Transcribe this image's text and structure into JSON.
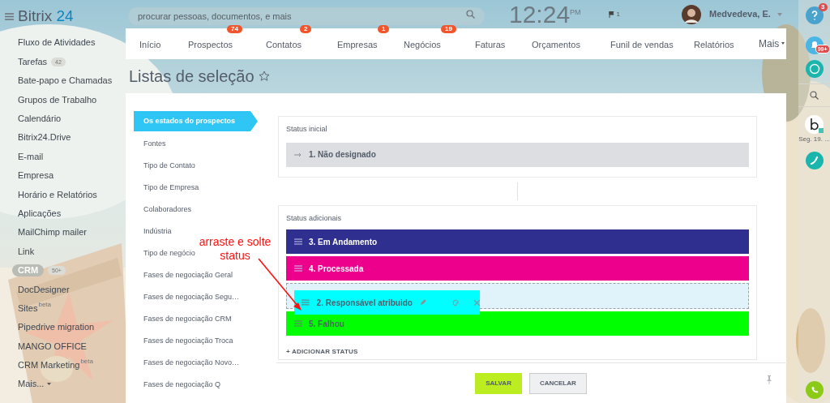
{
  "header": {
    "logo": {
      "text": "Bitrix",
      "accent": "24"
    },
    "search": {
      "placeholder": "procurar pessoas, documentos, e mais"
    },
    "clock": {
      "time": "12:24",
      "period": "PM"
    },
    "flags": "1",
    "user": "Medvedeva, E."
  },
  "sidebar": {
    "items": [
      {
        "label": "Fluxo de Atividades",
        "selected": false
      },
      {
        "label": "Tarefas",
        "counter": "42",
        "selected": false
      },
      {
        "label": "Bate-papo e Chamadas",
        "selected": false
      },
      {
        "label": "Grupos de Trabalho",
        "selected": false
      },
      {
        "label": "Calendário",
        "selected": false
      },
      {
        "label": "Bitrix24.Drive",
        "selected": false
      },
      {
        "label": "E-mail",
        "selected": false
      },
      {
        "label": "Empresa",
        "selected": false
      },
      {
        "label": "Horário e Relatórios",
        "selected": false
      },
      {
        "label": "Aplicações",
        "selected": false
      },
      {
        "label": "MailChimp mailer",
        "selected": false
      },
      {
        "label": "Link",
        "selected": false
      },
      {
        "label": "CRM",
        "counter": "50+",
        "selected": true
      },
      {
        "label": "DocDesigner",
        "selected": false
      },
      {
        "label": "Sites",
        "tag": "beta",
        "selected": false
      },
      {
        "label": "Pipedrive migration",
        "selected": false
      },
      {
        "label": "MANGO OFFICE",
        "selected": false
      },
      {
        "label": "CRM Marketing",
        "tag": "beta",
        "selected": false
      }
    ],
    "more": "Mais..."
  },
  "topnav": {
    "items": [
      {
        "label": "Início"
      },
      {
        "label": "Prospectos",
        "badge": "74"
      },
      {
        "label": "Contatos",
        "badge": "2"
      },
      {
        "label": "Empresas",
        "badge": "1"
      },
      {
        "label": "Negócios",
        "badge": "19"
      },
      {
        "label": "Faturas"
      },
      {
        "label": "Orçamentos"
      },
      {
        "label": "Funil de vendas"
      },
      {
        "label": "Relatórios"
      }
    ],
    "more": "Mais"
  },
  "page_title": "Listas de seleção",
  "lists": [
    {
      "label": "Os estados do prospectos",
      "selected": true
    },
    {
      "label": "Fontes",
      "selected": false
    },
    {
      "label": "Tipo de Contato",
      "selected": false
    },
    {
      "label": "Tipo de Empresa",
      "selected": false
    },
    {
      "label": "Colaboradores",
      "selected": false
    },
    {
      "label": "Indústria",
      "selected": false
    },
    {
      "label": "Tipo de negócio",
      "selected": false
    },
    {
      "label": "Fases de negociação Geral",
      "selected": false
    },
    {
      "label": "Fases de negociação Segu…",
      "selected": false
    },
    {
      "label": "Fases de negociação CRM",
      "selected": false
    },
    {
      "label": "Fases de negociação Troca",
      "selected": false
    },
    {
      "label": "Fases de negociação Novo…",
      "selected": false
    },
    {
      "label": "Fases de negociação Q",
      "selected": false
    }
  ],
  "initial_status": {
    "title": "Status inicial",
    "items": [
      {
        "label": "1. Não designado",
        "color": "#dcdee1"
      }
    ]
  },
  "additional_status": {
    "title": "Status adicionais",
    "items": [
      {
        "label": "3. Em Andamento",
        "color": "#2e2f8f",
        "kind": "item"
      },
      {
        "label": "4. Processada",
        "color": "#ec008c",
        "kind": "item"
      },
      {
        "kind": "placeholder"
      },
      {
        "label": "5. Falhou",
        "color": "#00ff00",
        "kind": "item"
      }
    ],
    "dragged": {
      "label": "2. Responsável atribuido",
      "color": "#00ffff"
    },
    "add": "+ ADICIONAR STATUS"
  },
  "buttons": [
    {
      "label": "SALVAR",
      "kind": "primary"
    },
    {
      "label": "CANCELAR",
      "kind": "secondary"
    }
  ],
  "annotation": "arraste e solte status",
  "right_bar": {
    "help_badge": "3",
    "notify_badge": "99+",
    "date": "Seg. 19. ..."
  }
}
